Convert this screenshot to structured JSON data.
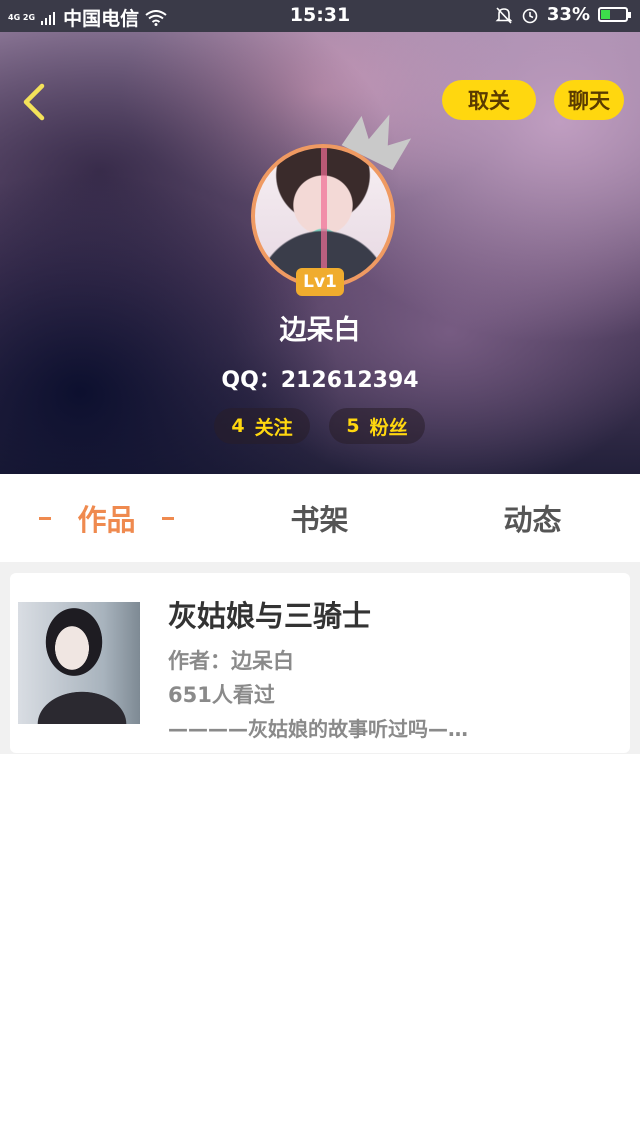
{
  "status_bar": {
    "network": "4G 2G",
    "carrier": "中国电信",
    "time": "15:31",
    "battery": "33%",
    "battery_level": 0.33
  },
  "header": {
    "unfollow_label": "取关",
    "chat_label": "聊天",
    "level": "Lv1",
    "nickname": "边呆白",
    "qq": "QQ：212612394",
    "following_count": "4",
    "following_label": "关注",
    "fans_count": "5",
    "fans_label": "粉丝"
  },
  "tabs": [
    {
      "label": "作品",
      "active": true
    },
    {
      "label": "书架",
      "active": false
    },
    {
      "label": "动态",
      "active": false
    }
  ],
  "works": [
    {
      "title": "灰姑娘与三骑士",
      "author": "作者：边呆白",
      "reads": "651人看过",
      "excerpt": "————灰姑娘的故事听过吗—…"
    }
  ],
  "colors": {
    "accent": "#ef8a4f",
    "button_yellow": "#ffd70f",
    "level_badge": "#f0ac2e"
  },
  "icons": [
    "back-arrow-icon",
    "crown-icon",
    "wifi-icon",
    "bell-muted-icon",
    "alarm-icon",
    "battery-icon"
  ]
}
